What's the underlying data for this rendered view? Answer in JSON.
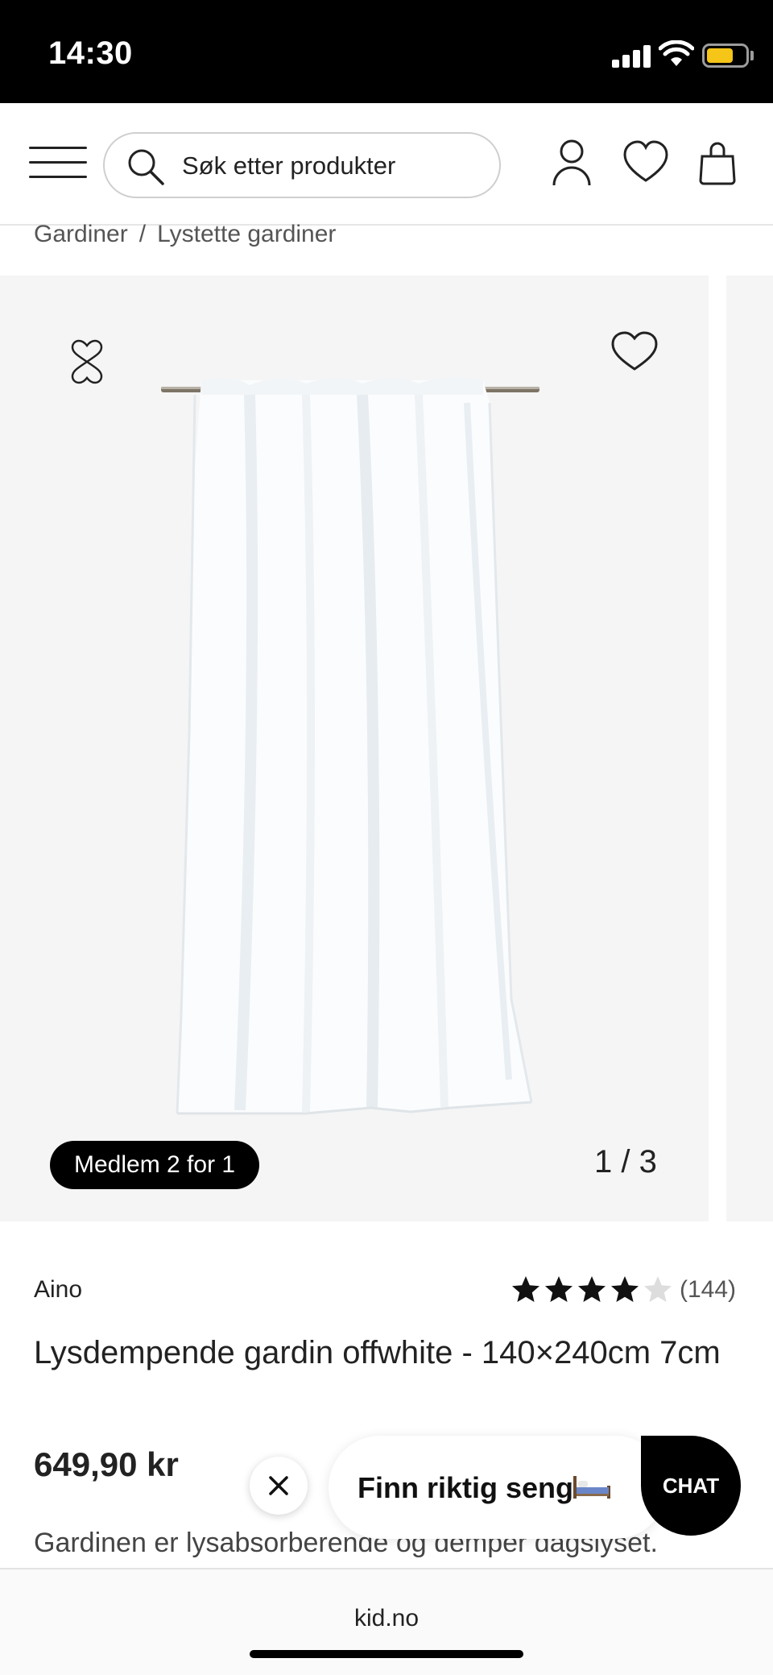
{
  "status_bar": {
    "time": "14:30"
  },
  "header": {
    "search_placeholder": "Søk etter produkter",
    "icons": [
      "menu-icon",
      "search-icon",
      "account-icon",
      "heart-icon",
      "bag-icon"
    ]
  },
  "breadcrumb": {
    "items": [
      "Gardiner",
      "Lystette gardiner"
    ],
    "separator": "/"
  },
  "gallery": {
    "promo_badge": "Medlem 2 for 1",
    "counter": "1 / 3",
    "current_image": 1,
    "total_images": 3
  },
  "product": {
    "brand": "Aino",
    "rating": {
      "stars_filled": 4,
      "stars_total": 5,
      "review_count": "(144)"
    },
    "title": "Lysdempende gardin offwhite - 140×240cm 7cm",
    "price": "649,90 kr",
    "description": "Gardinen er lysabsorberende og demper dagslyset."
  },
  "widgets": {
    "finder_label": "Finn riktig seng",
    "chat_label": "CHAT"
  },
  "browser": {
    "url": "kid.no"
  },
  "colors": {
    "accent": "#000000",
    "gallery_bg": "#f5f5f5",
    "star_empty": "#dddddd",
    "battery": "#f5c518"
  }
}
